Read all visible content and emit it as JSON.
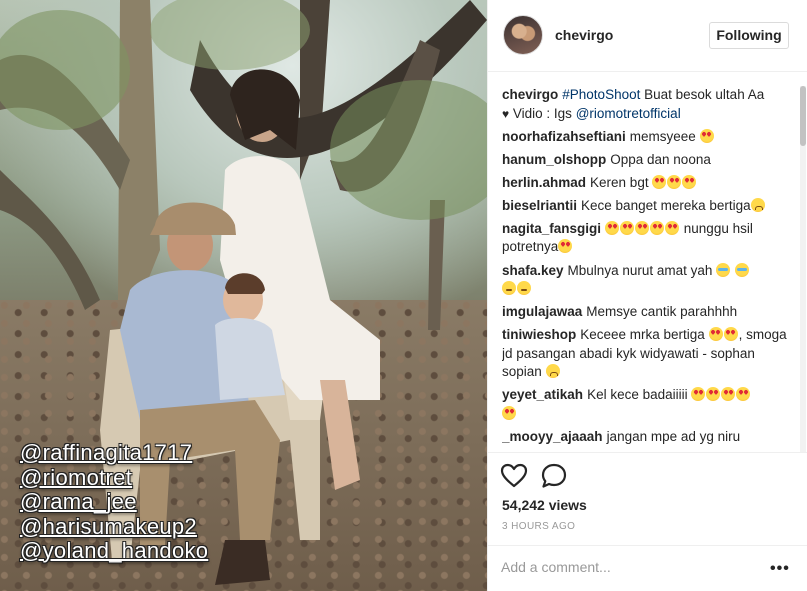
{
  "header": {
    "username": "chevirgo",
    "follow_label": "Following"
  },
  "caption": {
    "username": "chevirgo",
    "hashtag": "#PhotoShoot",
    "text_1": "Buat besok ultah Aa",
    "heart": "♥",
    "text_2": "Vidio : Igs",
    "mention": "@riomotretofficial"
  },
  "comments": [
    {
      "user": "noorhafizahseftiani",
      "text": "memsyeee",
      "emoji_after": [
        "heart-eyes"
      ]
    },
    {
      "user": "hanum_olshopp",
      "text": "Oppa dan noona",
      "emoji_after": []
    },
    {
      "user": "herlin.ahmad",
      "text": "Keren bgt",
      "emoji_after": [
        "heart-eyes",
        "heart-eyes",
        "heart-eyes"
      ]
    },
    {
      "user": "bieselriantii",
      "text": "Kece banget mereka bertiga",
      "emoji_after": [
        "worried"
      ]
    },
    {
      "user": "nagita_fansgigi",
      "text_before_emoji": "",
      "emoji_mid": [
        "heart-eyes",
        "heart-eyes",
        "heart-eyes",
        "heart-eyes",
        "heart-eyes"
      ],
      "text": "nunggu hsil potretnya",
      "emoji_after": [
        "heart-eyes"
      ]
    },
    {
      "user": "shafa.key",
      "text": "Mbulnya nurut amat yah",
      "emoji_after": [
        "cry",
        "cry",
        "plain",
        "plain"
      ]
    },
    {
      "user": "imgulajawaa",
      "text": "Memsye cantik parahhhh",
      "emoji_after": []
    },
    {
      "user": "tiniwieshop",
      "text": "Keceee mrka bertiga",
      "emoji_mid_after": [
        "heart-eyes",
        "heart-eyes"
      ],
      "text_2": ", smoga jd pasangan abadi kyk widyawati - sophan sopian",
      "emoji_after": [
        "worried"
      ]
    },
    {
      "user": "yeyet_atikah",
      "text": "Kel kece badaiiiii",
      "emoji_after": [
        "heart-eyes",
        "heart-eyes",
        "heart-eyes",
        "heart-eyes",
        "heart-eyes"
      ]
    },
    {
      "user": "_mooyy_ajaaah",
      "text": "jangan mpe ad yg niru",
      "emoji_after": []
    }
  ],
  "media_tags": [
    "@raffinagita1717",
    "@riomotret",
    "@rama_jee",
    "@harisumakeup2",
    "@yoland_handoko"
  ],
  "stats": {
    "views": "54,242 views",
    "time": "3 HOURS AGO"
  },
  "add_comment": {
    "placeholder": "Add a comment...",
    "more": "•••"
  },
  "icons": {
    "like": "heart-outline-icon",
    "comment": "speech-bubble-icon"
  }
}
